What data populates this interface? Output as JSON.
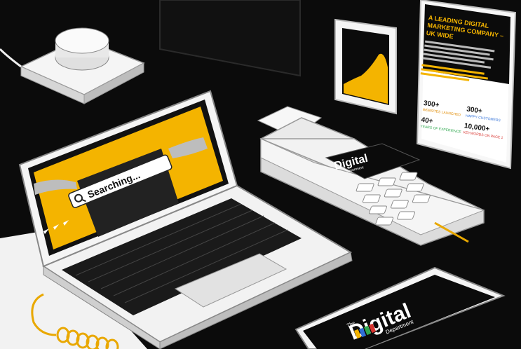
{
  "laptop": {
    "search_text": "Searching...",
    "accent_color": "#f4b400"
  },
  "phone_screen": {
    "headline_lines": [
      "A LEADING DIGITAL",
      "MARKETING COMPANY –",
      "UK WIDE"
    ],
    "stats": [
      {
        "value": "300+",
        "label": "WEBSITES LAUNCHED"
      },
      {
        "value": "300+",
        "label": "HAPPY CUSTOMERS"
      },
      {
        "value": "40+",
        "label": "YEARS OF EXPERIENCE"
      },
      {
        "value": "10,000+",
        "label": "KEYWORDS ON PAGE 1"
      }
    ]
  },
  "card_terminal": {
    "logo_main": "Digital",
    "logo_sub": "Department"
  },
  "bottom_phone": {
    "logo_prefix": "The",
    "logo_main": "Digital",
    "logo_sub": "Department"
  },
  "colors": {
    "background": "#0b0b0b",
    "device_white": "#f4f4f4",
    "accent_yellow": "#f4b400",
    "cable_yellow": "#e9a800"
  }
}
